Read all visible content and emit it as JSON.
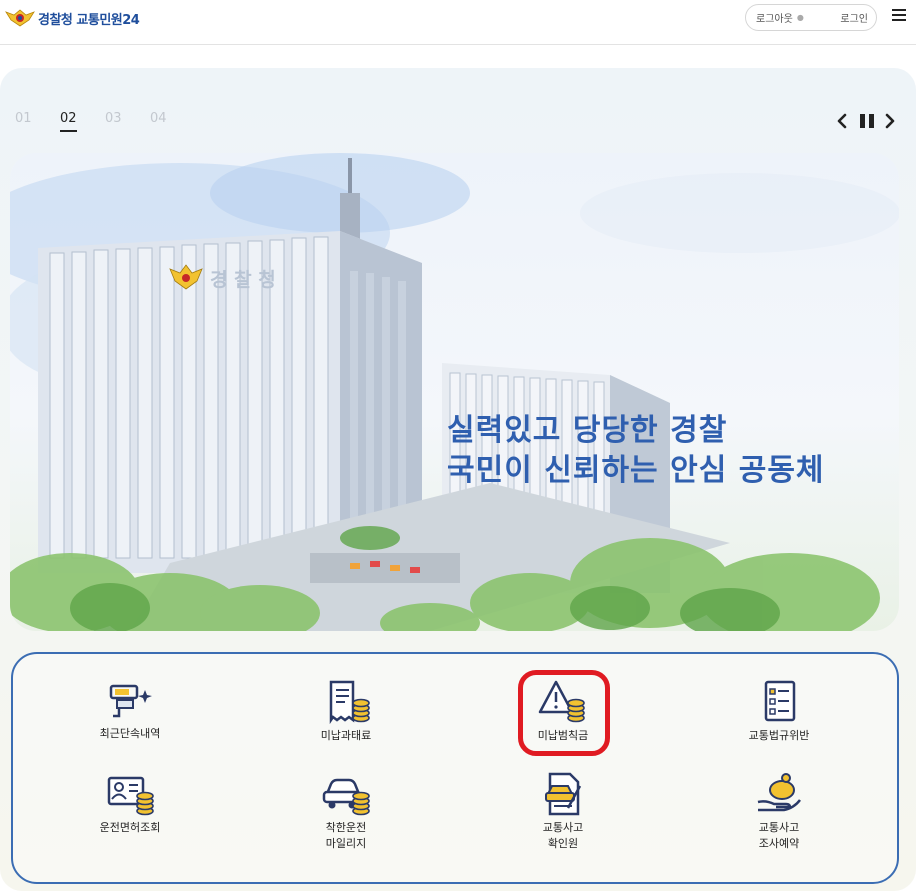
{
  "header": {
    "logo_text": "경찰청 교통민원24",
    "logout_label": "로그아웃",
    "login_label": "로그인",
    "menu_icon": "hamburger-icon"
  },
  "slider": {
    "pages": [
      "01",
      "02",
      "03",
      "04"
    ],
    "active_page": "02",
    "banner_line1": "실력있고 당당한 경찰",
    "banner_line2": "국민이 신뢰하는 안심 공동체",
    "building_sign": "경 찰 청"
  },
  "services": [
    {
      "label": "최근단속내역",
      "icon": "speed-camera-icon"
    },
    {
      "label": "미납과태료",
      "icon": "receipt-coins-icon"
    },
    {
      "label": "미납범칙금",
      "icon": "warning-coins-icon"
    },
    {
      "label": "교통법규위반",
      "icon": "checklist-icon"
    },
    {
      "label": "운전면허조회",
      "icon": "license-coins-icon"
    },
    {
      "label": "착한운전\n마일리지",
      "icon": "car-coins-icon"
    },
    {
      "label": "교통사고\n확인원",
      "icon": "car-document-icon"
    },
    {
      "label": "교통사고\n조사예약",
      "icon": "piggy-bank-hand-icon"
    }
  ],
  "colors": {
    "brand_blue": "#1f4e9c",
    "banner_text": "#2f5faf",
    "grid_border": "#3b6db3",
    "highlight": "#e01b22",
    "icon_gold": "#f2c230",
    "icon_navy": "#2b3a67"
  }
}
